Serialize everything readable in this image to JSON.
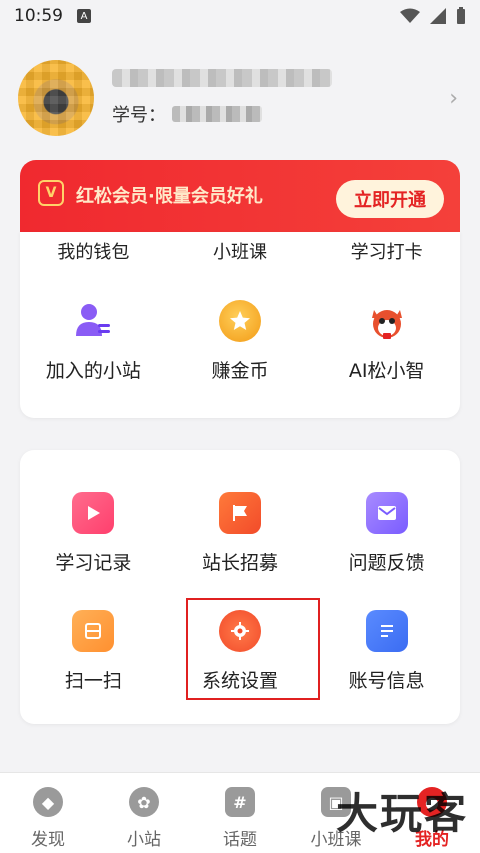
{
  "status_bar": {
    "time": "10:59",
    "badge": "A"
  },
  "profile": {
    "student_no_label": "学号："
  },
  "vip": {
    "title": "红松会员·限量会员好礼",
    "button": "立即开通"
  },
  "card1": {
    "partial_row": [
      "我的钱包",
      "小班课",
      "学习打卡"
    ],
    "items": [
      {
        "label": "加入的小站",
        "icon": "person-icon"
      },
      {
        "label": "赚金币",
        "icon": "star-coin-icon"
      },
      {
        "label": "AI松小智",
        "icon": "squirrel-icon"
      }
    ]
  },
  "card2": {
    "items": [
      {
        "label": "学习记录",
        "icon": "play-icon"
      },
      {
        "label": "站长招募",
        "icon": "flag-icon"
      },
      {
        "label": "问题反馈",
        "icon": "mail-icon"
      },
      {
        "label": "扫一扫",
        "icon": "scan-icon"
      },
      {
        "label": "系统设置",
        "icon": "gear-icon"
      },
      {
        "label": "账号信息",
        "icon": "doc-icon"
      }
    ]
  },
  "bottom_nav": {
    "tabs": [
      {
        "label": "发现"
      },
      {
        "label": "小站"
      },
      {
        "label": "话题"
      },
      {
        "label": "小班课"
      },
      {
        "label": "我的"
      }
    ]
  },
  "watermark": "大玩客",
  "colors": {
    "accent": "#e42323",
    "vip_bg": "#f0292f"
  }
}
